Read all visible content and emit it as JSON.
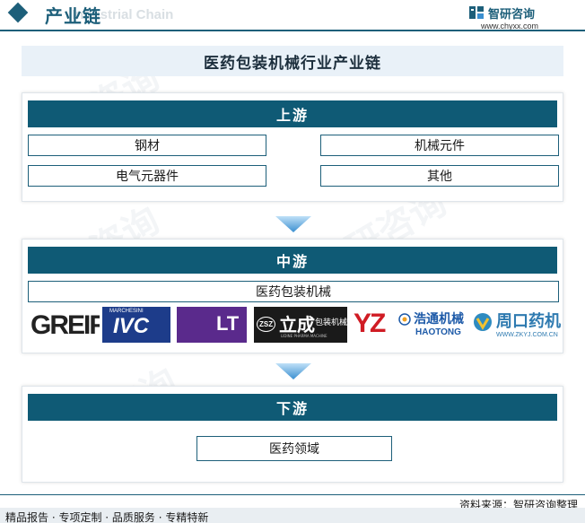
{
  "header": {
    "title": "产业链",
    "ghost_text": "Industrial Chain",
    "brand_name": "智研咨询",
    "brand_url": "www.chyxx.com"
  },
  "diagram": {
    "title": "医药包装机械行业产业链",
    "upstream": {
      "label": "上游",
      "items": [
        "钢材",
        "机械元件",
        "电气元器件",
        "其他"
      ]
    },
    "midstream": {
      "label": "中游",
      "item": "医药包装机械",
      "companies": [
        {
          "name": "GREIF"
        },
        {
          "name": "MARCHESINI",
          "mark": "IVC"
        },
        {
          "name": "LT"
        },
        {
          "name": "立成",
          "sub": "包装机械",
          "badge": "ZSZ",
          "tagline": "LIDINE PHARMA MACHINE"
        },
        {
          "name": "YZ"
        },
        {
          "name": "浩通机械",
          "sub": "HAOTONG"
        },
        {
          "name": "周口药机",
          "sub": "WWW.ZKYJ.COM.CN"
        }
      ]
    },
    "downstream": {
      "label": "下游",
      "item": "医药领域"
    }
  },
  "footer": {
    "source": "资料来源：智研咨询整理",
    "services": "精品报告 · 专项定制 · 品质服务 · 专精特新"
  },
  "colors": {
    "primary": "#1d5f7a",
    "head_fill": "#0f5a75",
    "title_bg": "#e9f1f8",
    "arrow": "#3a8fd0"
  }
}
